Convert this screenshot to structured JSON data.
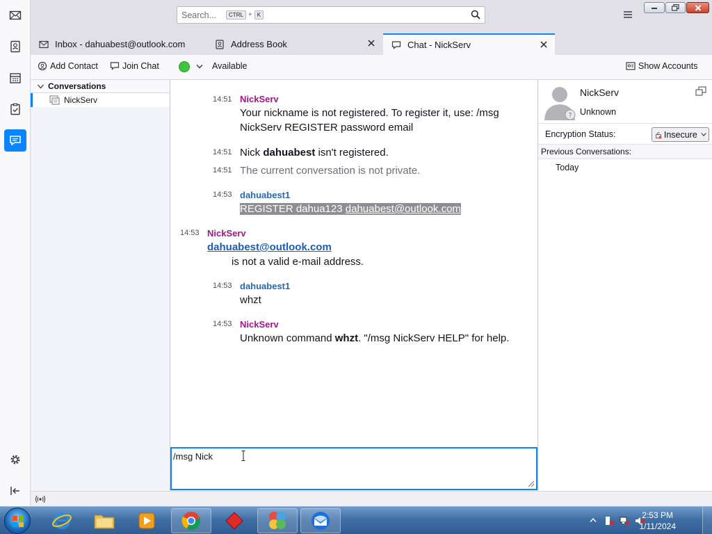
{
  "search": {
    "placeholder": "Search...",
    "key_ctrl": "CTRL",
    "key_plus": "+",
    "key_k": "K"
  },
  "tabs": [
    {
      "label": "Inbox - dahuabest@outlook.com"
    },
    {
      "label": "Address Book"
    },
    {
      "label": "Chat - NickServ"
    }
  ],
  "toolbar": {
    "add_contact": "Add Contact",
    "join_chat": "Join Chat",
    "status": "Available",
    "show_accounts": "Show Accounts",
    "status_color": "#3ec43e"
  },
  "conversations": {
    "header": "Conversations",
    "items": [
      {
        "name": "NickServ"
      }
    ]
  },
  "messages": [
    {
      "time": "14:51",
      "sender": "NickServ",
      "line1": "Your nickname is not registered. To register it, use: /msg",
      "line2": "NickServ REGISTER password email"
    },
    {
      "time": "14:51",
      "pre": "Nick ",
      "bold": "dahuabest",
      "post": " isn't registered."
    },
    {
      "time": "14:51",
      "text": "The current conversation is not private."
    },
    {
      "time": "14:53",
      "sender": "dahuabest1",
      "text_plain": "REGISTER dahua123 ",
      "text_link": "dahuabest@outlook.com"
    },
    {
      "time": "14:53",
      "sender": "NickServ",
      "link": "dahuabest@outlook.com",
      "text": "is not a valid e-mail address."
    },
    {
      "time": "14:53",
      "sender": "dahuabest1",
      "text": "whzt"
    },
    {
      "time": "14:53",
      "sender": "NickServ",
      "pre": "Unknown command ",
      "bold": "whzt",
      "post": ". \"/msg NickServ HELP\" for help."
    }
  ],
  "input": {
    "value": "/msg Nick"
  },
  "buddy": {
    "name": "NickServ",
    "status": "Unknown",
    "encryption_label": "Encryption Status:",
    "encryption_value": "Insecure",
    "previous_header": "Previous Conversations:",
    "previous_items": [
      "Today"
    ]
  },
  "clock": {
    "time": "2:53 PM",
    "date": "1/11/2024"
  }
}
